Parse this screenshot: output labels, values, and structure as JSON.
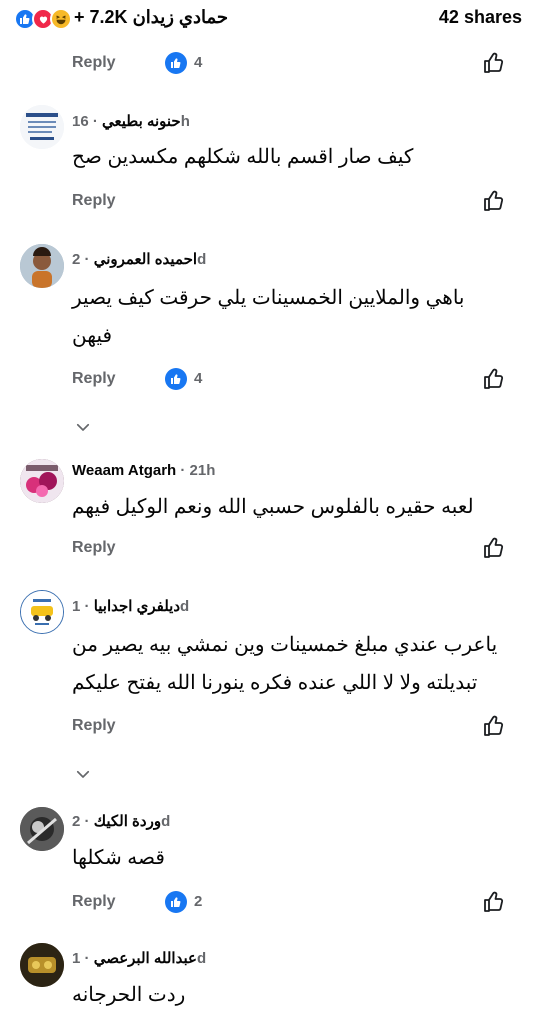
{
  "post": {
    "reaction_icons": [
      "like-icon",
      "love-icon",
      "haha-icon"
    ],
    "reaction_count": "+ 7.2K",
    "reaction_names": "حمادي زيدان",
    "shares": "42 shares"
  },
  "reply_label": "Reply",
  "colors": {
    "accent": "#1877f2",
    "muted": "#65676b",
    "text": "#050505"
  },
  "top_actions": {
    "like_count": "4"
  },
  "comments": [
    {
      "author": "حنونه بطيعي",
      "time": "16h",
      "text": "كيف صار اقسم بالله شكلهم مكسدين صح",
      "like_count": null
    },
    {
      "author": "احميده العمروني",
      "time": "2d",
      "text_lines": [
        "باهي والملايين الخمسينات يلي حرقت كيف يصير",
        "فيهن"
      ],
      "like_count": "4"
    },
    {
      "author": "Weaam Atgarh",
      "time": "21h",
      "text": "لعبه حقيره بالفلوس حسبي الله ونعم الوكيل فيهم",
      "like_count": null
    },
    {
      "author": "ديلفري اجدابيا",
      "time": "1d",
      "text_lines": [
        "ياعرب عندي مبلغ خمسينات وين نمشي بيه يصير من",
        "تبديلته ولا لا اللي عنده فكره ينورنا الله يفتح عليكم"
      ],
      "like_count": null
    },
    {
      "author": "وردة الكيك",
      "time": "2d",
      "text": "قصه شكلها",
      "like_count": "2"
    },
    {
      "author": "عبدالله البرعصي",
      "time": "1d",
      "text": "ردت الحرجانه",
      "like_count": null
    }
  ]
}
